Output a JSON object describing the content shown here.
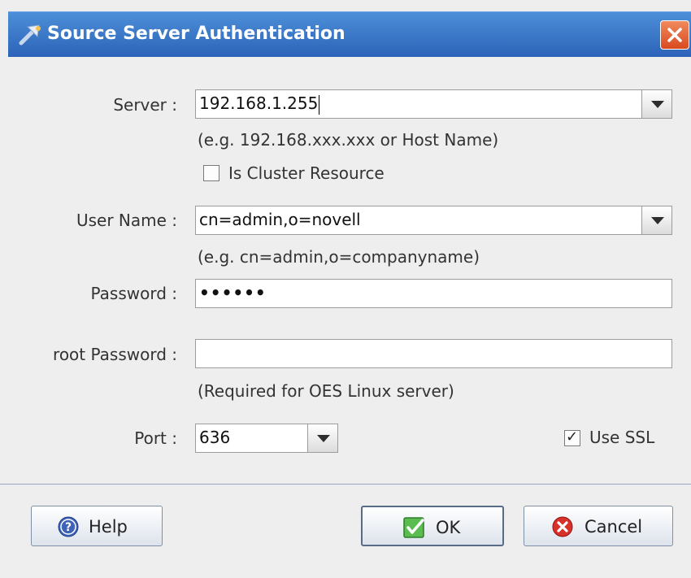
{
  "window": {
    "title": "Source Server Authentication"
  },
  "form": {
    "server_label": "Server :",
    "server_value": "192.168.1.255",
    "server_hint": "(e.g. 192.168.xxx.xxx or Host Name)",
    "cluster_label": "Is Cluster Resource",
    "cluster_checked": false,
    "username_label": "User Name :",
    "username_value": "cn=admin,o=novell",
    "username_hint": "(e.g. cn=admin,o=companyname)",
    "password_label": "Password :",
    "password_value": "••••••",
    "root_password_label": "root Password :",
    "root_password_value": "",
    "root_password_hint": "(Required for OES Linux server)",
    "port_label": "Port :",
    "port_value": "636",
    "ssl_label": "Use SSL",
    "ssl_checked": true
  },
  "buttons": {
    "help": "Help",
    "ok": "OK",
    "cancel": "Cancel"
  },
  "icons": {
    "title": "wizard-arrow-icon",
    "close": "close-icon",
    "help": "help-icon",
    "ok": "check-icon",
    "cancel": "cancel-icon"
  },
  "colors": {
    "titlebar": "#3a78c9",
    "close": "#e0602f",
    "ok_icon": "#3fa83a",
    "cancel_icon": "#d8302a",
    "help_icon": "#3d62b8"
  }
}
